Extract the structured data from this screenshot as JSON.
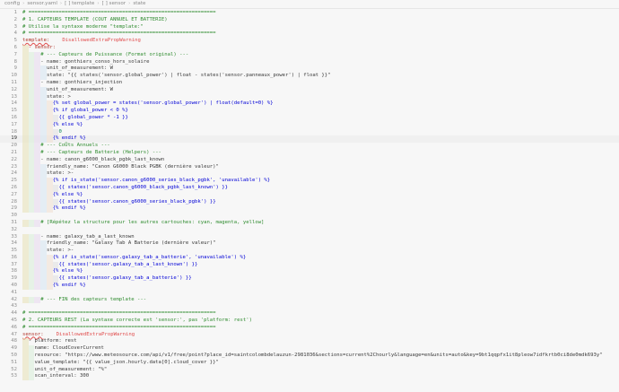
{
  "breadcrumb": {
    "items": [
      "config",
      "sensor.yaml",
      "[ ] template",
      "[ ] sensor",
      "state"
    ]
  },
  "editor": {
    "lines": [
      {
        "n": "1",
        "i": 0,
        "t": "# ==============================================================",
        "k": "comment"
      },
      {
        "n": "2",
        "i": 0,
        "t": "# 1. CAPTEURS TEMPLATE (COUT ANNUEL ET BATTERIE)",
        "k": "comment"
      },
      {
        "n": "3",
        "i": 0,
        "t": "# Utilise la syntaxe moderne \"template:\"",
        "k": "comment"
      },
      {
        "n": "4",
        "i": 0,
        "t": "# ==============================================================",
        "k": "comment"
      },
      {
        "n": "5",
        "i": 0,
        "t": "template:",
        "k": "key",
        "w": "DisallowedExtraPropWarning"
      },
      {
        "n": "6",
        "i": 1,
        "t": "- sensor:",
        "k": "key"
      },
      {
        "n": "7",
        "i": 3,
        "t": "# --- Capteurs de Puissance (Format original) ---",
        "k": "comment"
      },
      {
        "n": "8",
        "i": 3,
        "t": "- name: gonthiers_conso_hors_solaire",
        "k": "kv"
      },
      {
        "n": "9",
        "i": 4,
        "t": "unit_of_measurement: W",
        "k": "kv"
      },
      {
        "n": "10",
        "i": 4,
        "t": "state: \"{{ states('sensor.global_power') | float - states('sensor.panneaux_power') | float }}\"",
        "k": "str"
      },
      {
        "n": "11",
        "i": 3,
        "t": "- name: gonthiers_injection",
        "k": "kv"
      },
      {
        "n": "12",
        "i": 4,
        "t": "unit_of_measurement: W",
        "k": "kv"
      },
      {
        "n": "13",
        "i": 4,
        "t": "state: >",
        "k": "kv"
      },
      {
        "n": "14",
        "i": 5,
        "t": "{% set global_power = states('sensor.global_power') | float(default=0) %}",
        "k": "jinja"
      },
      {
        "n": "15",
        "i": 5,
        "t": "{% if global_power < 0 %}",
        "k": "jinja"
      },
      {
        "n": "16",
        "i": 6,
        "t": "{{ global_power * -1 }}",
        "k": "jinja"
      },
      {
        "n": "17",
        "i": 5,
        "t": "{% else %}",
        "k": "jinja"
      },
      {
        "n": "18",
        "i": 6,
        "t": "0",
        "k": "num"
      },
      {
        "n": "19",
        "i": 5,
        "t": "{% endif %}",
        "k": "jinja",
        "current": true
      },
      {
        "n": "20",
        "i": 3,
        "t": "# --- CoÛts Annuels ---",
        "k": "comment"
      },
      {
        "n": "21",
        "i": 3,
        "t": "# --- Capteurs de Batterie (Helpers) ---",
        "k": "comment"
      },
      {
        "n": "22",
        "i": 3,
        "t": "- name: canon_g6000_black_pgbk_last_known",
        "k": "kv"
      },
      {
        "n": "23",
        "i": 4,
        "t": "friendly_name: \"Canon G6000 Black PGBK (dernière valeur)\"",
        "k": "kvstr"
      },
      {
        "n": "24",
        "i": 4,
        "t": "state: >-",
        "k": "kv"
      },
      {
        "n": "25",
        "i": 5,
        "t": "{% if is_state('sensor.canon_g6000_series_black_pgbk', 'unavailable') %}",
        "k": "jinja"
      },
      {
        "n": "26",
        "i": 6,
        "t": "{{ states('sensor.canon_g6000_black_pgbk_last_known') }}",
        "k": "jinja"
      },
      {
        "n": "27",
        "i": 5,
        "t": "{% else %}",
        "k": "jinja"
      },
      {
        "n": "28",
        "i": 6,
        "t": "{{ states('sensor.canon_g6000_series_black_pgbk') }}",
        "k": "jinja"
      },
      {
        "n": "29",
        "i": 5,
        "t": "{% endif %}",
        "k": "jinja"
      },
      {
        "n": "30",
        "i": 0,
        "t": "",
        "k": "blank"
      },
      {
        "n": "31",
        "i": 3,
        "t": "# [Répétez la structure pour les autres cartouches: cyan, magenta, yellow]",
        "k": "comment"
      },
      {
        "n": "32",
        "i": 0,
        "t": "",
        "k": "blank"
      },
      {
        "n": "33",
        "i": 3,
        "t": "- name: galaxy_tab_a_last_known",
        "k": "kv"
      },
      {
        "n": "34",
        "i": 4,
        "t": "friendly_name: \"Galaxy Tab A Batterie (dernière valeur)\"",
        "k": "kvstr"
      },
      {
        "n": "35",
        "i": 4,
        "t": "state: >-",
        "k": "kv"
      },
      {
        "n": "36",
        "i": 5,
        "t": "{% if is_state('sensor.galaxy_tab_a_batterie', 'unavailable') %}",
        "k": "jinja"
      },
      {
        "n": "37",
        "i": 6,
        "t": "{{ states('sensor.galaxy_tab_a_last_known') }}",
        "k": "jinja"
      },
      {
        "n": "38",
        "i": 5,
        "t": "{% else %}",
        "k": "jinja"
      },
      {
        "n": "39",
        "i": 6,
        "t": "{{ states('sensor.galaxy_tab_a_batterie') }}",
        "k": "jinja"
      },
      {
        "n": "40",
        "i": 5,
        "t": "{% endif %}",
        "k": "jinja"
      },
      {
        "n": "41",
        "i": 0,
        "t": "",
        "k": "blank"
      },
      {
        "n": "42",
        "i": 3,
        "t": "# --- FIN des capteurs template ---",
        "k": "comment"
      },
      {
        "n": "43",
        "i": 0,
        "t": "",
        "k": "blank"
      },
      {
        "n": "44",
        "i": 0,
        "t": "# ==============================================================",
        "k": "comment"
      },
      {
        "n": "45",
        "i": 0,
        "t": "# 2. CAPTEURS REST (La syntaxe correcte est 'sensor:', pas 'platform: rest')",
        "k": "comment"
      },
      {
        "n": "46",
        "i": 0,
        "t": "# ==============================================================",
        "k": "comment"
      },
      {
        "n": "47",
        "i": 0,
        "t": "sensor:",
        "k": "key",
        "w": "DisallowedExtraPropWarning"
      },
      {
        "n": "48",
        "i": 1,
        "t": "- platform: rest",
        "k": "kv"
      },
      {
        "n": "49",
        "i": 2,
        "t": "name: CloudCoverCurrent",
        "k": "kv"
      },
      {
        "n": "50",
        "i": 2,
        "t": "resource: \"https://www.meteosource.com/api/v1/free/point?place_id=saintcolombdelauzun-2981036&sections=current%2Chourly&language=en&units=auto&key=9bt1qqpfx1it8pleow7idfkrtb0ci8de0mdk693y\"",
        "k": "kvstr"
      },
      {
        "n": "51",
        "i": 2,
        "t": "value_template: \"{{ value_json.hourly.data[0].cloud_cover }}\"",
        "k": "kvstr"
      },
      {
        "n": "52",
        "i": 2,
        "t": "unit_of_measurement: \"%\"",
        "k": "kvstr"
      },
      {
        "n": "53",
        "i": 2,
        "t": "scan_interval: 300",
        "k": "kvnum"
      }
    ]
  },
  "colors": {
    "comment": "#2e8b2e",
    "key": "#b0342a",
    "string": "#a31515",
    "jinja": "#0000d6",
    "warning": "#e04c4c",
    "background": "#f7f7f7"
  }
}
